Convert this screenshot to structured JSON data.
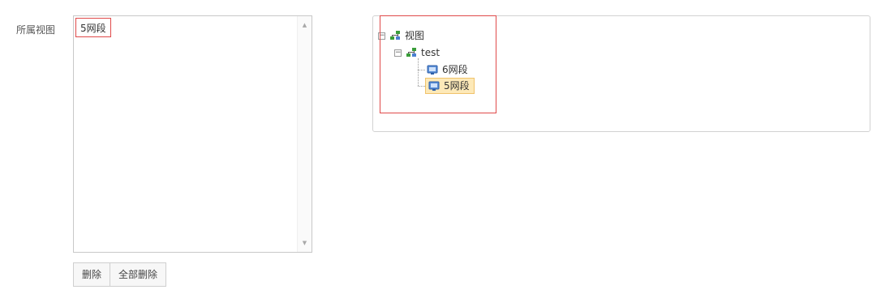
{
  "form": {
    "label": "所属视图"
  },
  "selected_list": {
    "items": [
      "5网段"
    ]
  },
  "buttons": {
    "delete": "删除",
    "delete_all": "全部删除"
  },
  "tree": {
    "root": {
      "label": "视图",
      "expanded": true,
      "icon": "network-group-icon",
      "children": [
        {
          "label": "test",
          "expanded": true,
          "icon": "network-group-icon",
          "children": [
            {
              "label": "6网段",
              "icon": "monitor-icon",
              "selected": false
            },
            {
              "label": "5网段",
              "icon": "monitor-icon",
              "selected": true
            }
          ]
        }
      ]
    }
  },
  "colors": {
    "highlight_border": "#e04a4a",
    "selected_bg": "#fde9b8",
    "selected_border": "#f0c36b"
  }
}
